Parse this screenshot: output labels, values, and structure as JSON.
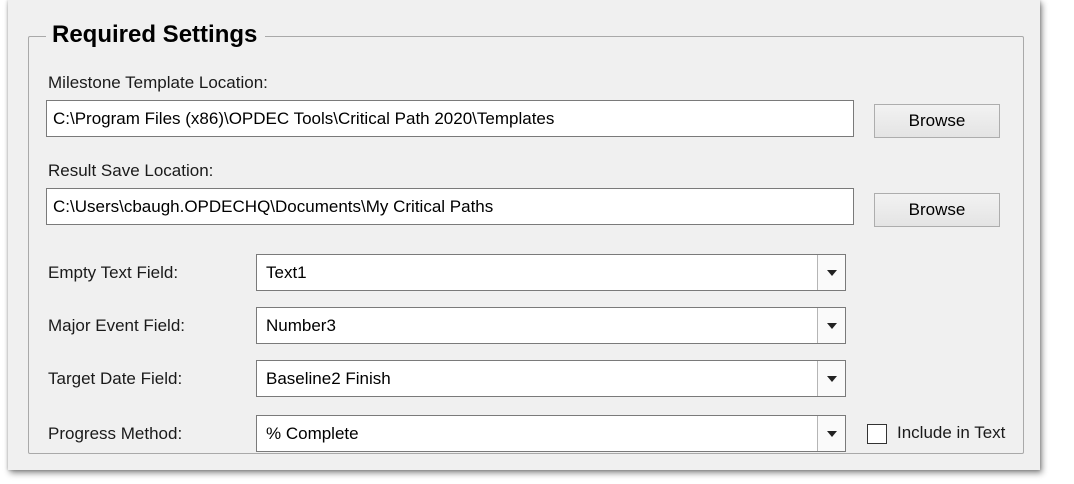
{
  "group": {
    "title": "Required Settings"
  },
  "template": {
    "label": "Milestone Template Location:",
    "value": "C:\\Program Files (x86)\\OPDEC Tools\\Critical Path 2020\\Templates",
    "browse_label": "Browse"
  },
  "result": {
    "label": "Result Save Location:",
    "value": "C:\\Users\\cbaugh.OPDECHQ\\Documents\\My Critical Paths",
    "browse_label": "Browse"
  },
  "fields": {
    "empty_text": {
      "label": "Empty Text Field:",
      "value": "Text1"
    },
    "major_event": {
      "label": "Major Event Field:",
      "value": "Number3"
    },
    "target_date": {
      "label": "Target Date Field:",
      "value": "Baseline2 Finish"
    },
    "progress_method": {
      "label": "Progress Method:",
      "value": "% Complete"
    }
  },
  "include_in_text": {
    "label": "Include in Text",
    "checked": false
  },
  "icons": {
    "dropdown": "chevron-down-icon"
  }
}
